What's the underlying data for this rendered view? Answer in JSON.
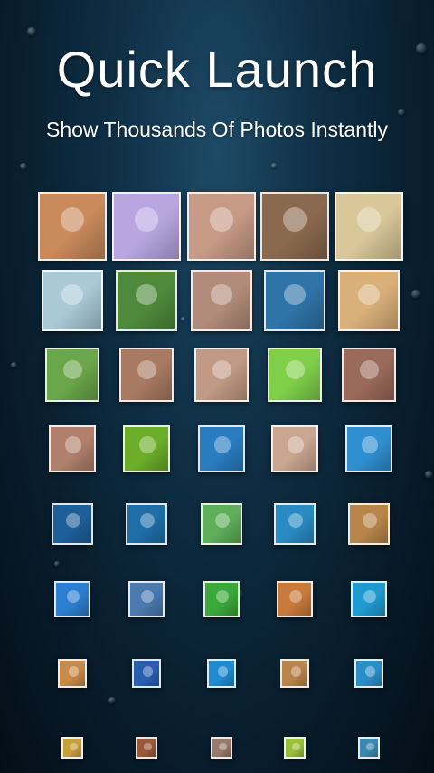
{
  "header": {
    "title": "Quick Launch",
    "subtitle": "Show Thousands Of Photos Instantly"
  },
  "colors": {
    "background_dark": "#081c2b",
    "background_light": "#1e4a66",
    "text": "#ffffff"
  },
  "photo_grid": {
    "rows": [
      [
        "#c98a5c",
        "#b9a6e0",
        "#c79a86",
        "#8a6a4e",
        "#d9c79a"
      ],
      [
        "#a9c9d6",
        "#4f8a3c",
        "#b28c7a",
        "#2f74a8",
        "#d9b07a"
      ],
      [
        "#6aa64a",
        "#a87a62",
        "#c09a84",
        "#7fcf4a",
        "#9a6a5a"
      ],
      [
        "#b0806c",
        "#6cae2a",
        "#2a7cc0",
        "#c8a690",
        "#2f8fd0"
      ],
      [
        "#1e5f9a",
        "#1f6ea8",
        "#5fae5a",
        "#2a8ac2",
        "#b8864a"
      ],
      [
        "#2c7fd0",
        "#4a7ab0",
        "#3aa83a",
        "#c87a3a",
        "#1f9acf"
      ],
      [
        "#c98a4a",
        "#2a5fb0",
        "#1f8ad0",
        "#b8844a",
        "#2a8fc8"
      ],
      [
        "#c8a03a",
        "#9a5a3a",
        "#9a7a6a",
        "#9abf3a",
        "#3a8ab0"
      ]
    ]
  }
}
